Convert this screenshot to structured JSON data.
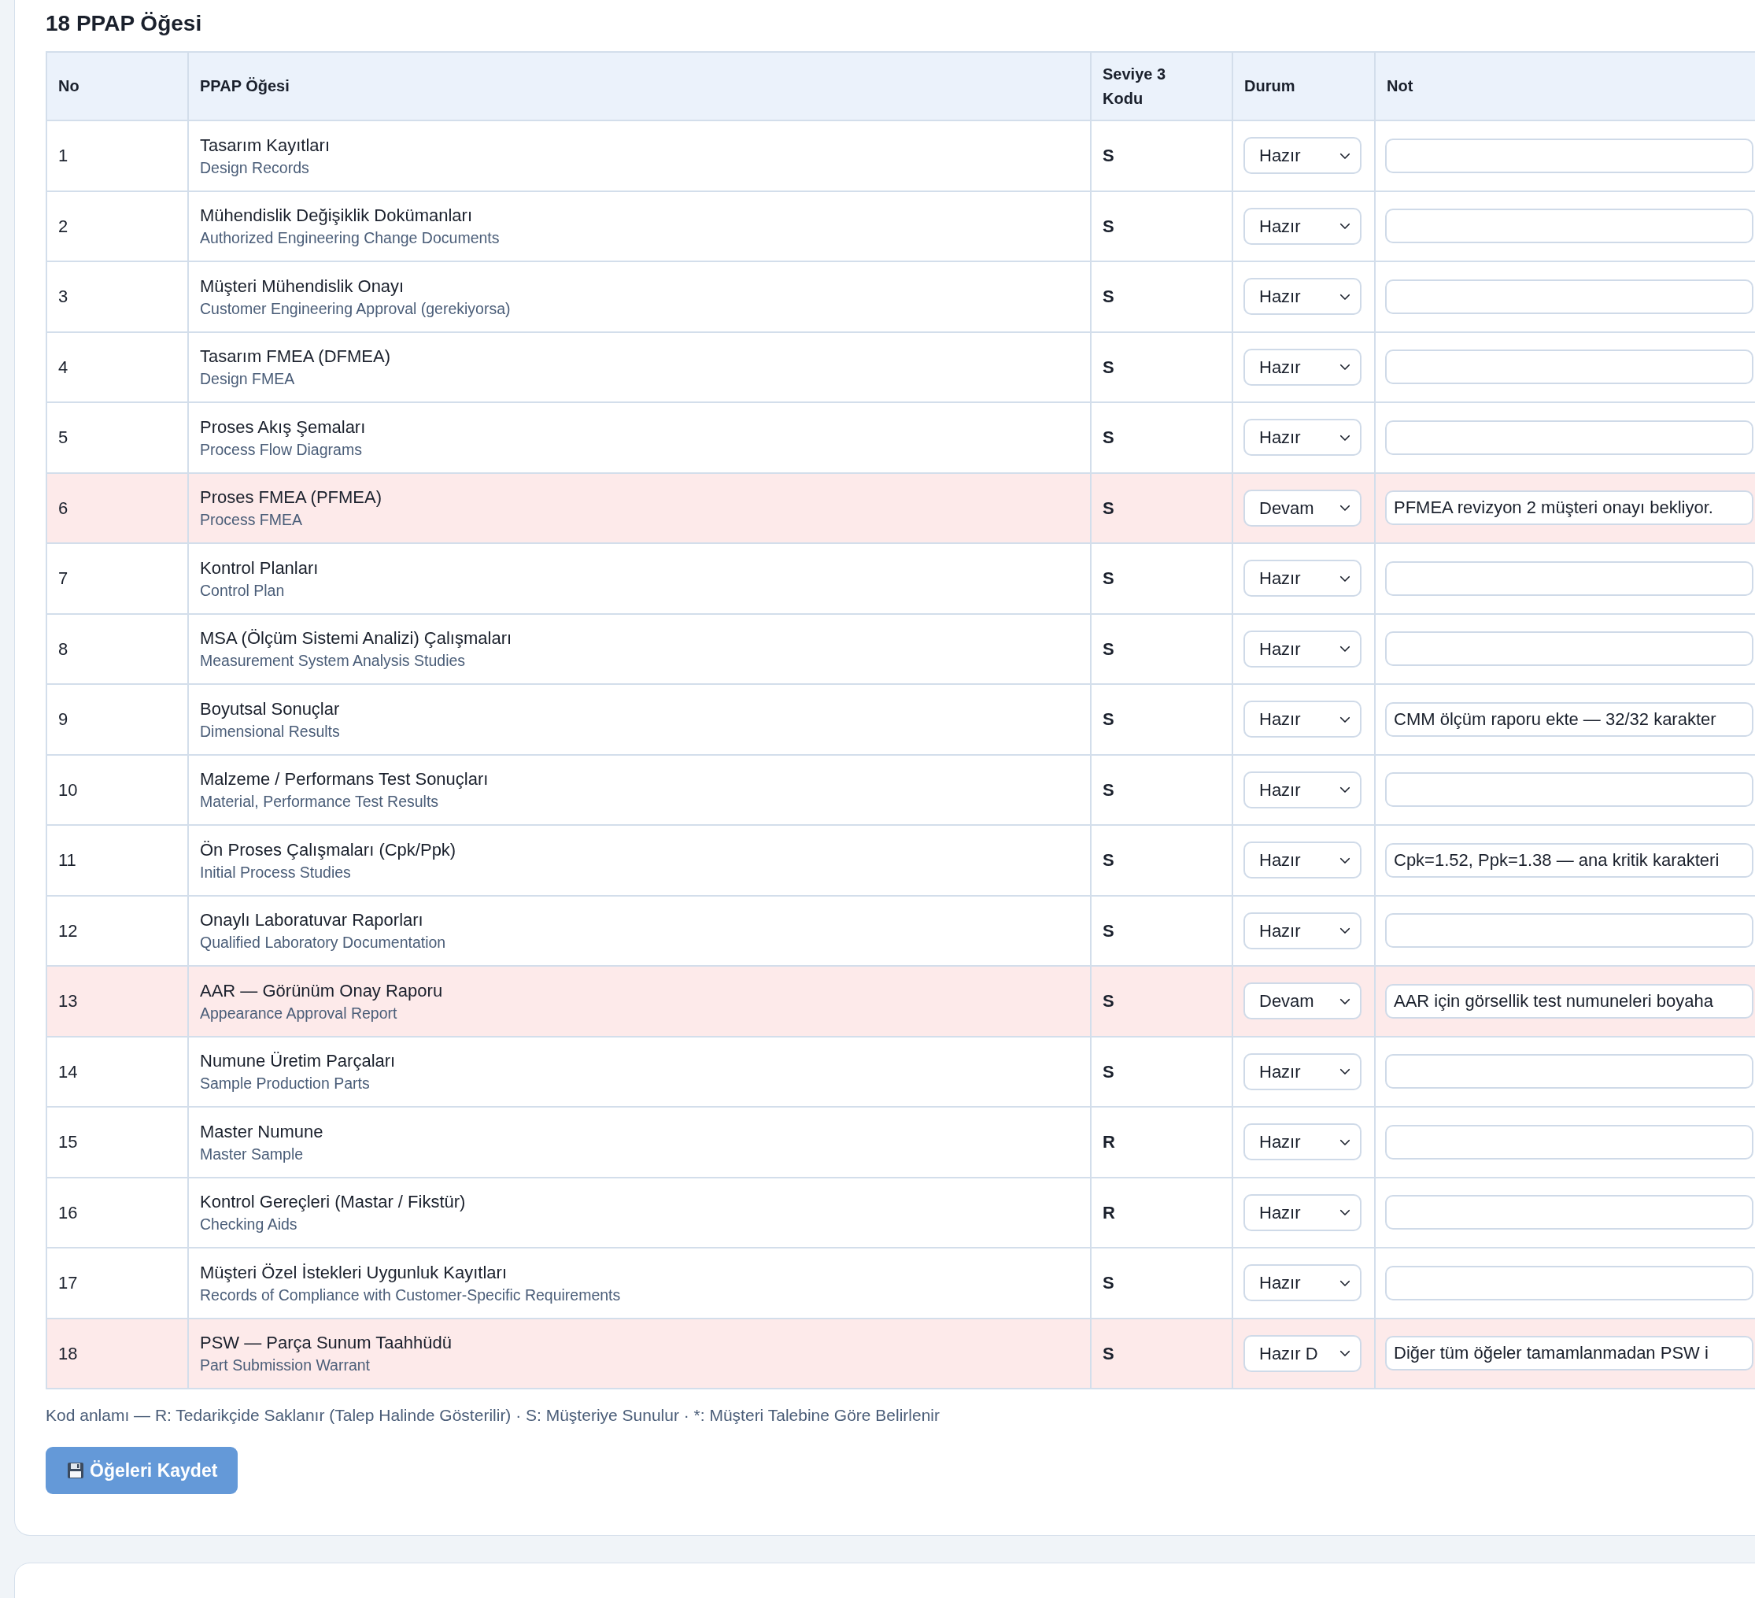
{
  "section": {
    "title": "18 PPAP Öğesi"
  },
  "table": {
    "columns": [
      "No",
      "PPAP Öğesi",
      "Seviye 3 Kodu",
      "Durum",
      "Not"
    ],
    "rows": [
      {
        "no": "1",
        "name": "Tasarım Kayıtları",
        "name_en": "Design Records",
        "code": "S",
        "status": "Hazır",
        "highlighted": false
      },
      {
        "no": "2",
        "name": "Mühendislik Değişiklik Dokümanları",
        "name_en": "Authorized Engineering Change Documents",
        "code": "S",
        "status": "Hazır",
        "highlighted": false
      },
      {
        "no": "3",
        "name": "Müşteri Mühendislik Onayı",
        "name_en": "Customer Engineering Approval (gerekiyorsa)",
        "code": "S",
        "status": "Hazır",
        "highlighted": false
      },
      {
        "no": "4",
        "name": "Tasarım FMEA (DFMEA)",
        "name_en": "Design FMEA",
        "code": "S",
        "status": "Hazır",
        "highlighted": false
      },
      {
        "no": "5",
        "name": "Proses Akış Şemaları",
        "name_en": "Process Flow Diagrams",
        "code": "S",
        "status": "Hazır",
        "highlighted": false
      },
      {
        "no": "6",
        "name": "Proses FMEA (PFMEA)",
        "name_en": "Process FMEA",
        "code": "S",
        "status": "Devam",
        "highlighted": true,
        "note": "PFMEA revizyon 2 müşteri onayı bekliyor."
      },
      {
        "no": "7",
        "name": "Kontrol Planları",
        "name_en": "Control Plan",
        "code": "S",
        "status": "Hazır",
        "highlighted": false
      },
      {
        "no": "8",
        "name": "MSA (Ölçüm Sistemi Analizi) Çalışmaları",
        "name_en": "Measurement System Analysis Studies",
        "code": "S",
        "status": "Hazır",
        "highlighted": false
      },
      {
        "no": "9",
        "name": "Boyutsal Sonuçlar",
        "name_en": "Dimensional Results",
        "code": "S",
        "status": "Hazır",
        "highlighted": false,
        "note": "CMM ölçüm raporu ekte — 32/32 karakter"
      },
      {
        "no": "10",
        "name": "Malzeme / Performans Test Sonuçları",
        "name_en": "Material, Performance Test Results",
        "code": "S",
        "status": "Hazır",
        "highlighted": false
      },
      {
        "no": "11",
        "name": "Ön Proses Çalışmaları (Cpk/Ppk)",
        "name_en": "Initial Process Studies",
        "code": "S",
        "status": "Hazır",
        "highlighted": false,
        "note": "Cpk=1.52, Ppk=1.38 — ana kritik karakteri"
      },
      {
        "no": "12",
        "name": "Onaylı Laboratuvar Raporları",
        "name_en": "Qualified Laboratory Documentation",
        "code": "S",
        "status": "Hazır",
        "highlighted": false
      },
      {
        "no": "13",
        "name": "AAR — Görünüm Onay Raporu",
        "name_en": "Appearance Approval Report",
        "code": "S",
        "status": "Devam",
        "highlighted": true,
        "note": "AAR için görsellik test numuneleri boyaha"
      },
      {
        "no": "14",
        "name": "Numune Üretim Parçaları",
        "name_en": "Sample Production Parts",
        "code": "S",
        "status": "Hazır",
        "highlighted": false
      },
      {
        "no": "15",
        "name": "Master Numune",
        "name_en": "Master Sample",
        "code": "R",
        "status": "Hazır",
        "highlighted": false
      },
      {
        "no": "16",
        "name": "Kontrol Gereçleri (Mastar / Fikstür)",
        "name_en": "Checking Aids",
        "code": "R",
        "status": "Hazır",
        "highlighted": false
      },
      {
        "no": "17",
        "name": "Müşteri Özel İstekleri Uygunluk Kayıtları",
        "name_en": "Records of Compliance with Customer-Specific Requirements",
        "code": "S",
        "status": "Hazır",
        "highlighted": false
      },
      {
        "no": "18",
        "name": "PSW — Parça Sunum Taahhüdü",
        "name_en": "Part Submission Warrant",
        "code": "S",
        "status": "Hazır D",
        "highlighted": true,
        "note": "Diğer tüm öğeler tamamlanmadan PSW i"
      }
    ]
  },
  "legend": "Kod anlamı — R: Tedarikçide Saklanır (Talep Halinde Gösterilir) · S: Müşteriye Sunulur · *: Müşteri Talebine Göre Belirlenir",
  "save_button": {
    "label": "Öğeleri Kaydet"
  }
}
